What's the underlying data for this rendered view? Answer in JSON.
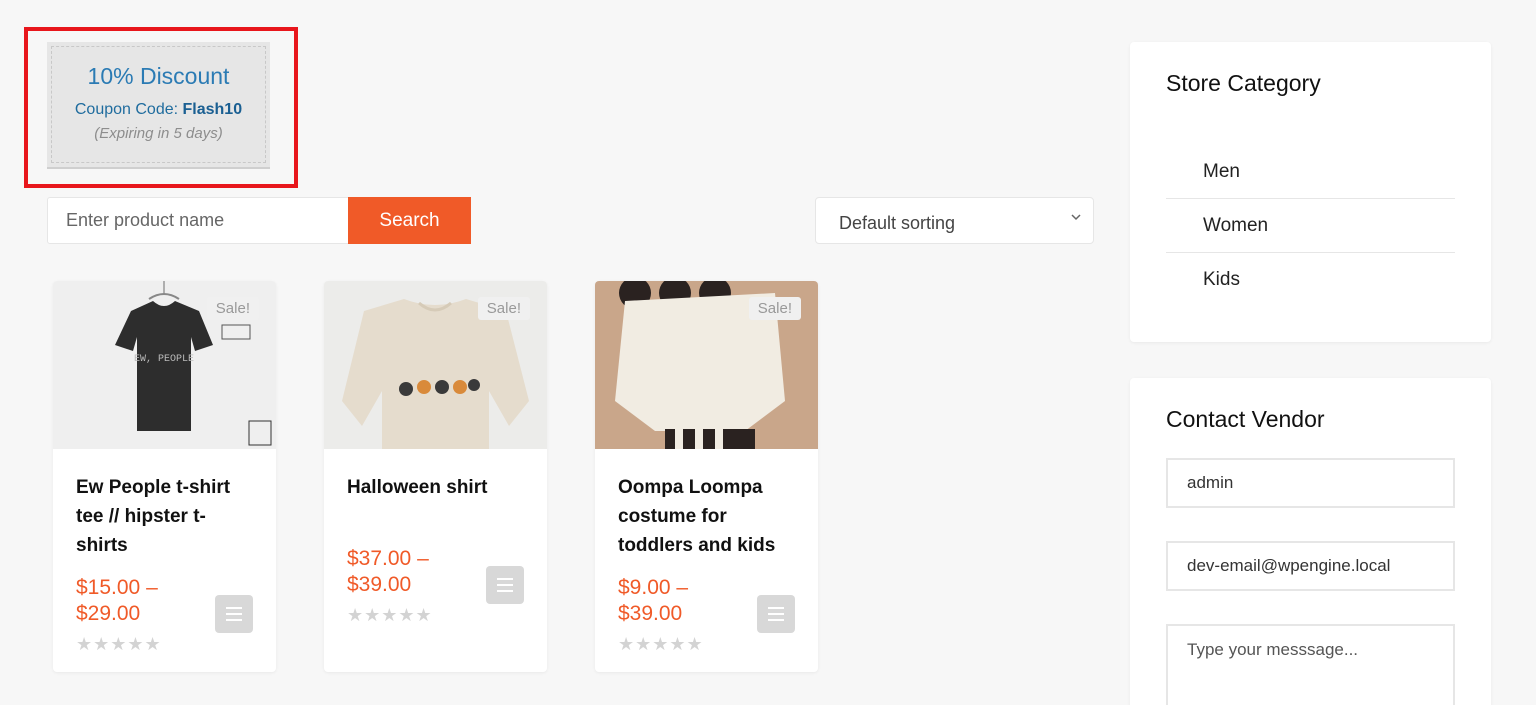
{
  "coupon": {
    "title": "10% Discount",
    "code_label": "Coupon Code: ",
    "code": "Flash10",
    "expiry": "(Expiring in 5 days)",
    "highlight_color": "#e8161c"
  },
  "search": {
    "placeholder": "Enter product name",
    "button_label": "Search"
  },
  "sort": {
    "selected": "Default sorting",
    "arrow_icon": "chevron-down-icon"
  },
  "products": [
    {
      "title": "Ew People t-shirt tee // hipster t-shirts",
      "price": "$15.00 – $29.00",
      "badge": "Sale!",
      "rating": "★★★★★",
      "image_icon": "tshirt-image"
    },
    {
      "title": "Halloween shirt",
      "price": "$37.00 – $39.00",
      "badge": "Sale!",
      "rating": "★★★★★",
      "image_icon": "sweatshirt-image"
    },
    {
      "title": "Oompa Loompa costume for toddlers and kids",
      "price": "$9.00 – $39.00",
      "badge": "Sale!",
      "rating": "★★★★★",
      "image_icon": "costume-image"
    }
  ],
  "sidebar": {
    "category_title": "Store Category",
    "categories": [
      "Men",
      "Women",
      "Kids"
    ],
    "contact_title": "Contact Vendor",
    "name_value": "admin",
    "email_value": "dev-email@wpengine.local",
    "message_placeholder": "Type your messsage..."
  },
  "colors": {
    "accent": "#f05a28",
    "coupon_text": "#2b7bb4",
    "background": "#f7f7f7"
  }
}
